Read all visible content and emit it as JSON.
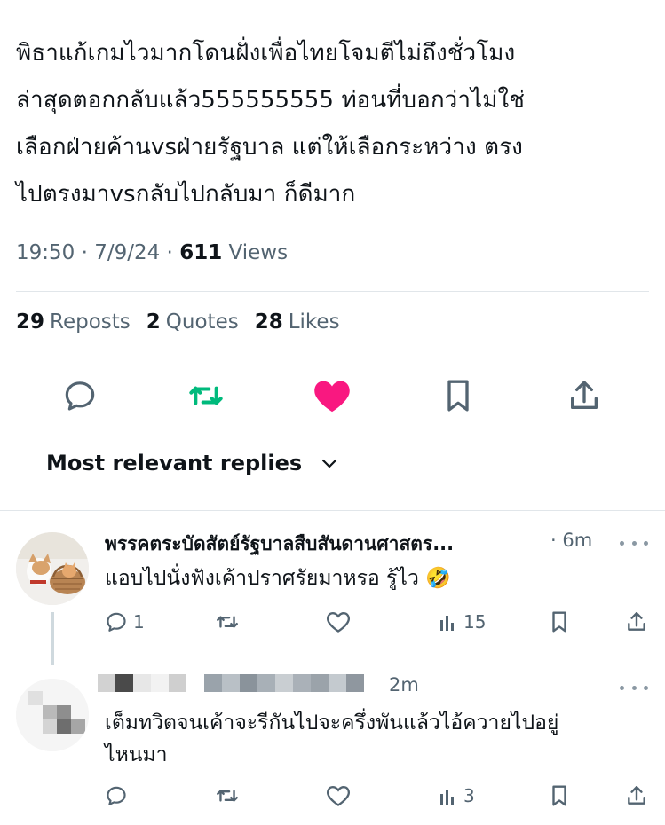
{
  "tweet": {
    "lines": [
      "พิธาแก้เกมไวมากโดนฝั่งเพื่อไทยโจมตีไม่ถึงชั่วโมง",
      "ล่าสุดตอกกลับแล้ว555555555 ท่อนที่บอกว่าไม่ใช่",
      "เลือกฝ่ายค้านvsฝ่ายรัฐบาล แต่ให้เลือกระหว่าง ตรง",
      "ไปตรงมาvsกลับไปกลับมา ก็ดีมาก"
    ],
    "time": "19:50 · 7/9/24 · ",
    "views_count": "611",
    "views_label": " Views"
  },
  "stats": {
    "reposts_count": "29",
    "reposts_label": "Reposts",
    "quotes_count": "2",
    "quotes_label": "Quotes",
    "likes_count": "28",
    "likes_label": "Likes"
  },
  "actions": {
    "reply_icon": "reply-icon",
    "repost_icon": "repost-icon",
    "like_icon": "heart-icon",
    "bookmark_icon": "bookmark-icon",
    "share_icon": "share-icon"
  },
  "replies_filter": {
    "label": "Most relevant replies"
  },
  "replies": [
    {
      "name": "พรรคตระบัดสัตย์รัฐบาลสืบสันดานศาสตร...",
      "time": "· 6m",
      "text_lines": [
        "แอบไปนั่งฟังเค้าปราศรัยมาหรอ รู้ไว 🤣"
      ],
      "reply_count": "1",
      "repost_count": "",
      "like_count": "",
      "views_count": "15"
    },
    {
      "name": "",
      "time": "2m",
      "text_lines": [
        "เต็มทวิตจนเค้าจะรีกันไปจะครึ่งพันแล้วไอ้ควายไปอยู่",
        "ไหนมา"
      ],
      "reply_count": "",
      "repost_count": "",
      "like_count": "",
      "views_count": "3"
    }
  ],
  "colors": {
    "text": "#0f1419",
    "secondary": "#536471",
    "repost_green": "#00ba7c",
    "like_pink": "#f91880"
  }
}
